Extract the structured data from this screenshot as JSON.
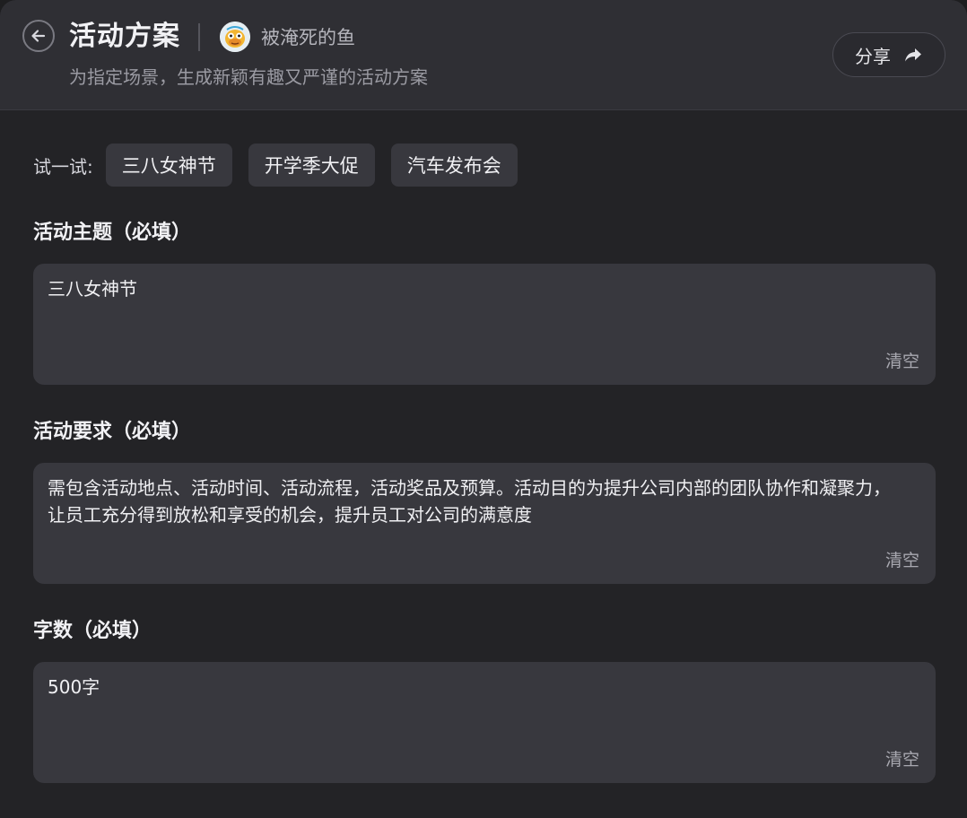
{
  "header": {
    "title": "活动方案",
    "author": "被淹死的鱼",
    "subtitle": "为指定场景，生成新颖有趣又严谨的活动方案",
    "share_label": "分享"
  },
  "try": {
    "label": "试一试:",
    "chips": [
      "三八女神节",
      "开学季大促",
      "汽车发布会"
    ]
  },
  "fields": [
    {
      "label": "活动主题（必填）",
      "value": "三八女神节",
      "clear_label": "清空"
    },
    {
      "label": "活动要求（必填）",
      "value": "需包含活动地点、活动时间、活动流程，活动奖品及预算。活动目的为提升公司内部的团队协作和凝聚力，让员工充分得到放松和享受的机会，提升员工对公司的满意度",
      "clear_label": "清空"
    },
    {
      "label": "字数（必填）",
      "value": "500字",
      "clear_label": "清空"
    }
  ],
  "icons": {
    "back": "back-arrow-icon",
    "share": "share-arrow-icon",
    "avatar": "fish-avatar"
  },
  "colors": {
    "background": "#232326",
    "header_bg": "#2f2f34",
    "field_bg": "#38383e",
    "text": "#f0f0f3",
    "muted": "#9b9ba3"
  }
}
